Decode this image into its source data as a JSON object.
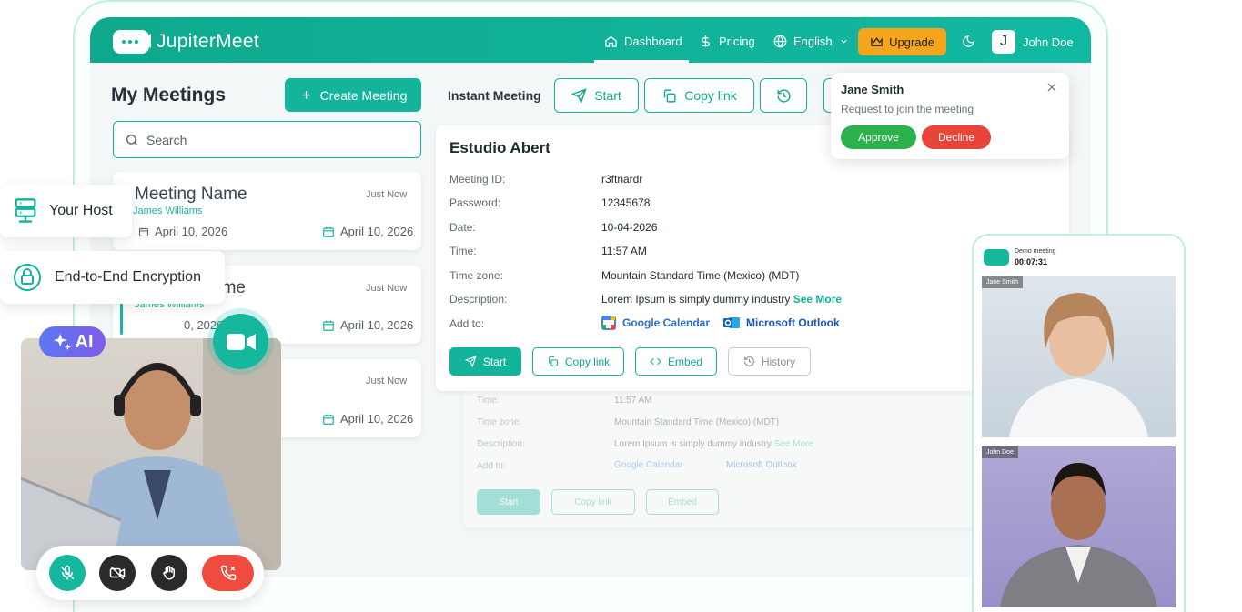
{
  "brand": {
    "name": "JupiterMeet"
  },
  "nav": {
    "dashboard": "Dashboard",
    "pricing": "Pricing",
    "language": "English",
    "upgrade": "Upgrade",
    "user_initial": "J",
    "user_name": "John Doe"
  },
  "sidebar": {
    "title": "My Meetings",
    "create_label": "Create Meeting",
    "search_placeholder": "Search",
    "meetings": [
      {
        "title": "Meeting Name",
        "host": "James Williams",
        "time": "Just Now",
        "start_date": "April 10, 2026",
        "end_date": "April 10, 2026"
      },
      {
        "title": "ame",
        "host": "James Williams",
        "time": "Just Now",
        "start_date": "0, 2026",
        "end_date": "April 10, 2026"
      },
      {
        "time": "Just Now",
        "end_date": "April 10, 2026"
      }
    ]
  },
  "instant": {
    "label": "Instant Meeting",
    "start": "Start",
    "copy": "Copy link"
  },
  "detail": {
    "title": "Estudio Abert",
    "fields": [
      {
        "label": "Meeting ID:",
        "value": "r3ftnardr"
      },
      {
        "label": "Password:",
        "value": "12345678"
      },
      {
        "label": "Date:",
        "value": "10-04-2026"
      },
      {
        "label": "Time:",
        "value": "11:57 AM"
      },
      {
        "label": "Time zone:",
        "value": "Mountain Standard Time (Mexico) (MDT)"
      },
      {
        "label": "Description:",
        "value": "Lorem Ipsum is simply dummy industry",
        "link": "See More"
      }
    ],
    "add_to_label": "Add to:",
    "google": "Google Calendar",
    "outlook": "Microsoft Outlook",
    "actions": {
      "start": "Start",
      "copy": "Copy link",
      "embed": "Embed",
      "history": "History"
    }
  },
  "ghost": {
    "time_label": "Time:",
    "time_value": "11:57 AM",
    "tz_label": "Time zone:",
    "tz_value": "Mountain Standard Time (Mexico) (MDT)",
    "desc_label": "Description:",
    "desc_value": "Lorem Ipsum is simply dummy industry",
    "desc_link": "See More",
    "add_label": "Add to:",
    "google": "Google Calendar",
    "outlook": "Microsoft Outlook",
    "start": "Start",
    "copy": "Copy link",
    "embed": "Embed"
  },
  "notification": {
    "name": "Jane Smith",
    "message": "Request to join the meeting",
    "approve": "Approve",
    "decline": "Decline"
  },
  "features": {
    "host": "Your Host",
    "encryption": "End-to-End Encryption",
    "ai": "AI"
  },
  "phone": {
    "meeting_name": "Demo meeting",
    "timer": "00:07:31",
    "tile1": "Jane Smith",
    "tile2": "John Doe"
  },
  "colors": {
    "accent": "#12B39C",
    "upgrade": "#F4A51C",
    "approve": "#2BB24C",
    "decline": "#E8443A",
    "end_call": "#EF4B3F",
    "dark_button": "#2A2A2A"
  }
}
